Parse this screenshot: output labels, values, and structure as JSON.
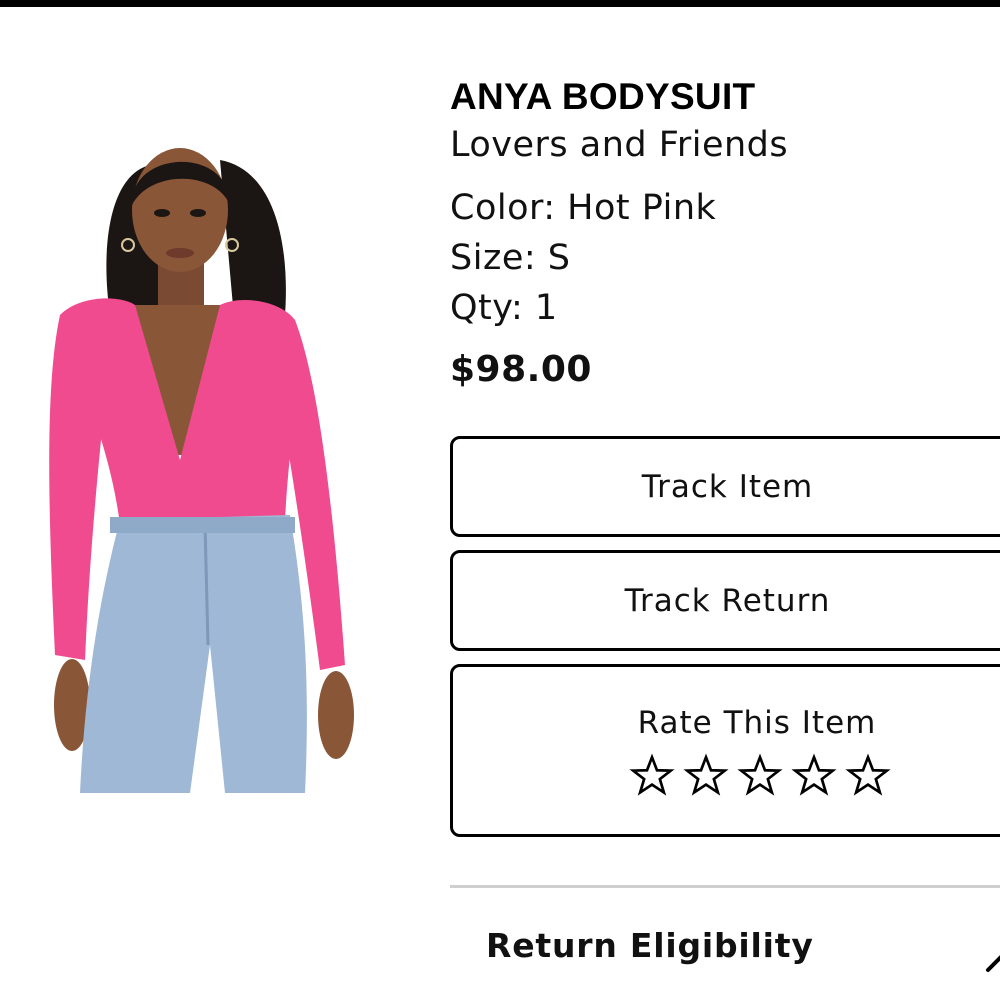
{
  "product": {
    "title": "ANYA BODYSUIT",
    "brand": "Lovers and Friends",
    "color": "Color: Hot Pink",
    "size": "Size: S",
    "qty": "Qty: 1",
    "price": "$98.00",
    "image_icon": "product-photo-model-pink-bodysuit"
  },
  "actions": {
    "track_item": "Track Item",
    "track_return": "Track Return",
    "rate_label": "Rate This Item",
    "rating": 0,
    "max_rating": 5
  },
  "sections": {
    "return_eligibility": "Return Eligibility"
  },
  "colors": {
    "accent": "#000000",
    "bodysuit": "#ef4b8e",
    "denim": "#9fb8d6",
    "divider": "#cfcfcf"
  }
}
